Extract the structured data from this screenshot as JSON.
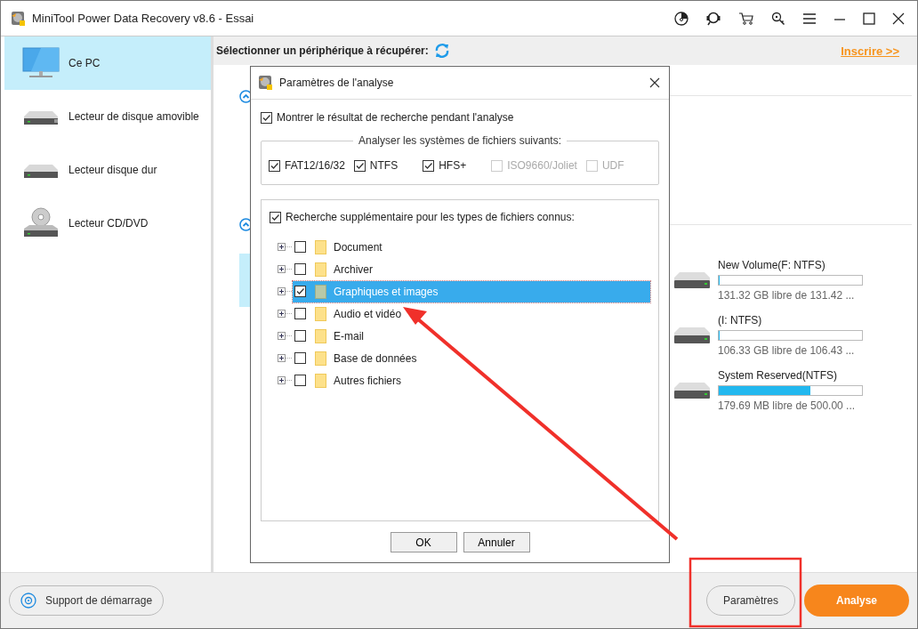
{
  "window": {
    "title": "MiniTool Power Data Recovery v8.6 - Essai"
  },
  "sidebar": {
    "items": [
      {
        "label": "Ce PC",
        "kind": "monitor",
        "selected": true
      },
      {
        "label": "Lecteur de disque amovible",
        "kind": "removable",
        "selected": false
      },
      {
        "label": "Lecteur disque dur",
        "kind": "harddisk",
        "selected": false
      },
      {
        "label": "Lecteur CD/DVD",
        "kind": "cd",
        "selected": false
      }
    ]
  },
  "header": {
    "title": "Sélectionner un périphérique à récupérer:",
    "link": "Inscrire >>"
  },
  "drives": [
    {
      "name": "New Volume(F: NTFS)",
      "level": 0.001,
      "info": "131.32 GB libre de 131.42 ..."
    },
    {
      "name": "(I: NTFS)",
      "level": 0.001,
      "info": "106.33 GB libre de 106.43 ..."
    },
    {
      "name": "System Reserved(NTFS)",
      "level": 0.64,
      "info": "179.69 MB libre de 500.00 ..."
    }
  ],
  "dialog": {
    "title": "Paramètres de l'analyse",
    "show_results": {
      "label": "Montrer le résultat de recherche pendant l'analyse",
      "checked": true
    },
    "filesystems_title": "Analyser les systèmes de fichiers suivants:",
    "filesystems": [
      {
        "label": "FAT12/16/32",
        "checked": true,
        "disabled": false
      },
      {
        "label": "NTFS",
        "checked": true,
        "disabled": false
      },
      {
        "label": "HFS+",
        "checked": true,
        "disabled": false
      },
      {
        "label": "ISO9660/Joliet",
        "checked": false,
        "disabled": true
      },
      {
        "label": "UDF",
        "checked": false,
        "disabled": true
      }
    ],
    "extra_search": {
      "label": "Recherche supplémentaire pour les types de fichiers connus:",
      "checked": true
    },
    "file_types": [
      {
        "label": "Document",
        "checked": false,
        "selected": false
      },
      {
        "label": "Archiver",
        "checked": false,
        "selected": false
      },
      {
        "label": "Graphiques et images",
        "checked": true,
        "selected": true
      },
      {
        "label": "Audio et vidéo",
        "checked": false,
        "selected": false
      },
      {
        "label": "E-mail",
        "checked": false,
        "selected": false
      },
      {
        "label": "Base de données",
        "checked": false,
        "selected": false
      },
      {
        "label": "Autres fichiers",
        "checked": false,
        "selected": false
      }
    ],
    "buttons": [
      "OK",
      "Annuler"
    ]
  },
  "footer": {
    "boot_media": "Support de démarrage",
    "settings": "Paramètres",
    "scan": "Analyse"
  }
}
